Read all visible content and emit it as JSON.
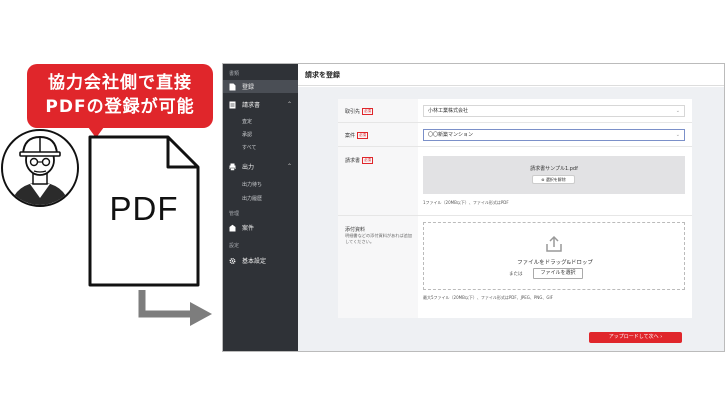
{
  "callout": {
    "line1": "協力会社側で直接",
    "line2": "PDFの登録が可能"
  },
  "illustration": {
    "document_label": "PDF"
  },
  "sidebar": {
    "section_doc": "書類",
    "items": [
      {
        "label": "登録",
        "icon": "file-icon"
      },
      {
        "label": "請求書",
        "icon": "document-icon"
      },
      {
        "label": "出力",
        "icon": "print-icon"
      },
      {
        "label": "案件",
        "icon": "building-icon"
      },
      {
        "label": "基本設定",
        "icon": "gear-icon"
      }
    ],
    "invoice_sub": [
      "査定",
      "承認",
      "すべて"
    ],
    "output_sub": [
      "出力待ち",
      "出力履歴"
    ],
    "section_manage": "管理",
    "section_settings": "設定"
  },
  "page": {
    "title": "請求を登録"
  },
  "form": {
    "required_badge": "必須",
    "client_label": "取引先",
    "client_value": "小林工業株式会社",
    "project_label": "案件",
    "project_value": "〇〇新築マンション",
    "invoice_label": "請求書",
    "invoice_file": "請求書サンプル1.pdf",
    "remove_button": "選択を解除",
    "invoice_note": "1ファイル（20MB以下）、ファイル形式はPDF",
    "attach_label": "添付資料",
    "attach_desc": "明細書などの添付資料があれば追加してください。",
    "drop_title": "ファイルをドラッグ&ドロップ",
    "drop_or": "または",
    "choose_button": "ファイルを選択",
    "attach_note": "最大5ファイル（20MB以下）、ファイル形式はPDF、JPEG、PNG、GIF"
  },
  "submit": {
    "label": "アップロードして次へ ›"
  },
  "colors": {
    "brand_red": "#e0262b",
    "sidebar_bg": "#2f3237"
  }
}
